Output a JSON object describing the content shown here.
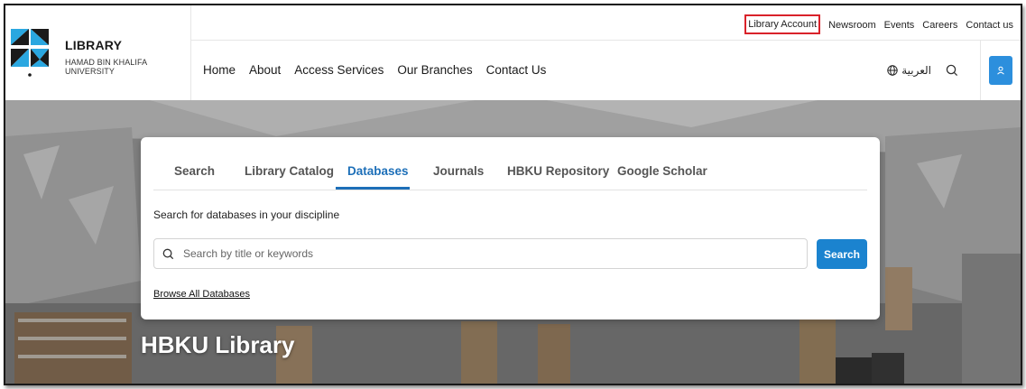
{
  "logo": {
    "title": "LIBRARY",
    "subtitle": "HAMAD BIN KHALIFA UNIVERSITY"
  },
  "utility_links": [
    "Library Account",
    "Newsroom",
    "Events",
    "Careers",
    "Contact us"
  ],
  "nav": {
    "items": [
      "Home",
      "About",
      "Access Services",
      "Our Branches",
      "Contact Us"
    ],
    "language": "العربية"
  },
  "search_card": {
    "tabs": [
      "Search",
      "Library Catalog",
      "Databases",
      "Journals",
      "HBKU Repository",
      "Google Scholar"
    ],
    "active_tab": "Databases",
    "instruction": "Search for databases in your discipline",
    "input": {
      "value": "",
      "placeholder": "Search by title or keywords"
    },
    "search_button": "Search",
    "browse_link": "Browse All Databases"
  },
  "hero": {
    "title": "HBKU Library"
  },
  "colors": {
    "accent": "#1d6fb8",
    "button": "#1b83cf",
    "user_button": "#2c8fdd",
    "highlight_box": "#d9222a"
  },
  "icons": [
    "logo-triangles-icon",
    "globe-icon",
    "search-icon",
    "user-icon"
  ]
}
